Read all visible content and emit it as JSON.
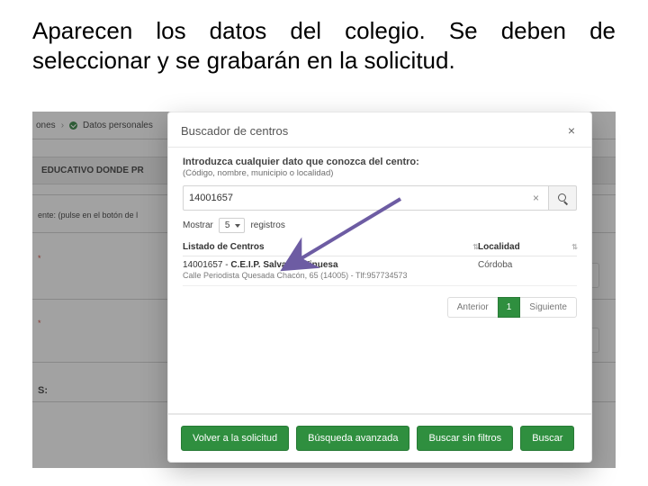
{
  "caption": "Aparecen los datos del colegio. Se deben de seleccionar y se grabarán en la solicitud.",
  "bg": {
    "breadcrumb_tail": "ones",
    "breadcrumb_current": "Datos personales",
    "section_head": "EDUCATIVO DONDE PR",
    "hint_line": "ente: (pulse en el botón de l",
    "star": "*",
    "bottom_s": "S:"
  },
  "modal": {
    "title": "Buscador de centros",
    "label": "Introduzca cualquier dato que conozca del centro:",
    "sublabel": "(Código, nombre, municipio o localidad)",
    "input_value": "14001657",
    "show_prefix": "Mostrar",
    "show_count": "5",
    "show_suffix": "registros",
    "col_list": "Listado de Centros",
    "col_loc": "Localidad",
    "row": {
      "code": "14001657 - ",
      "name": "C.E.I.P. Salvador Vinuesa",
      "addr": "Calle Periodista Quesada Chacón, 65 (14005) - Tlf:957734573",
      "loc": "Córdoba"
    },
    "pager_prev": "Anterior",
    "pager_page": "1",
    "pager_next": "Siguiente",
    "footer": {
      "back": "Volver a la solicitud",
      "advanced": "Búsqueda avanzada",
      "nofilter": "Buscar sin filtros",
      "search": "Buscar"
    }
  }
}
